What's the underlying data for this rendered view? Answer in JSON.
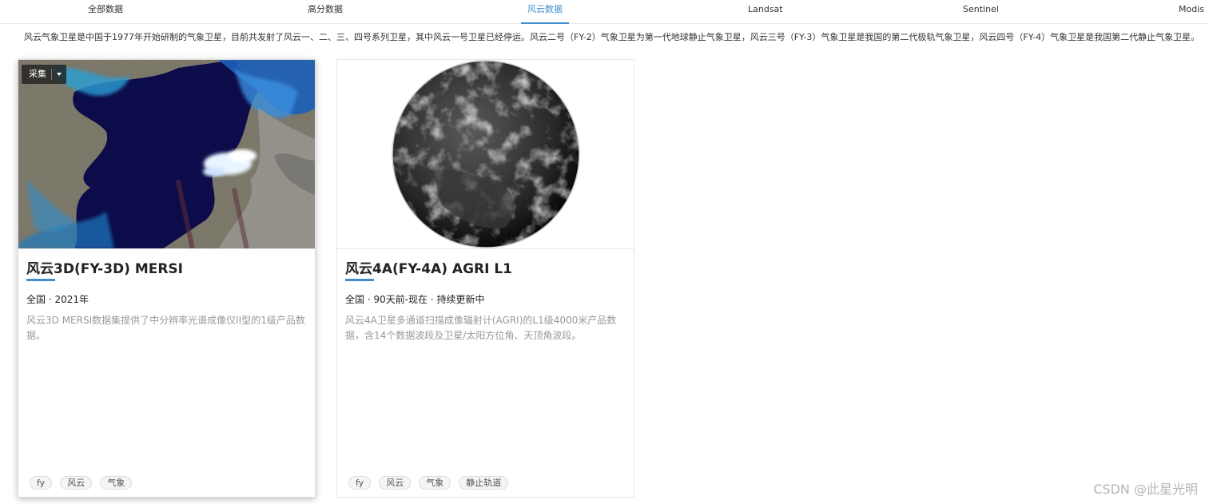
{
  "tabs": [
    {
      "label": "全部数据",
      "active": false
    },
    {
      "label": "高分数据",
      "active": false
    },
    {
      "label": "风云数据",
      "active": true
    },
    {
      "label": "Landsat",
      "active": false
    },
    {
      "label": "Sentinel",
      "active": false
    },
    {
      "label": "Modis",
      "active": false
    }
  ],
  "intro": "风云气象卫星是中国于1977年开始研制的气象卫星，目前共发射了风云一、二、三、四号系列卫星，其中风云一号卫星已经停运。风云二号（FY-2）气象卫星为第一代地球静止气象卫星，风云三号（FY-3）气象卫星是我国的第二代极轨气象卫星，风云四号（FY-4）气象卫星是我国第二代静止气象卫星。",
  "cards": [
    {
      "collect_label": "采集",
      "title": "风云3D(FY-3D) MERSI",
      "meta": "全国 · 2021年",
      "desc": "风云3D MERSI数据集提供了中分辨率光谱成像仪II型的1级产品数据。",
      "tags": [
        "fy",
        "风云",
        "气象"
      ]
    },
    {
      "title": "风云4A(FY-4A) AGRI L1",
      "meta": "全国 · 90天前-现在 · 持续更新中",
      "desc": "风云4A卫星多通道扫描成像辐射计(AGRI)的L1级4000米产品数据，含14个数据波段及卫星/太阳方位角、天顶角波段。",
      "tags": [
        "fy",
        "风云",
        "气象",
        "静止轨道"
      ]
    }
  ],
  "watermark": "CSDN @此星光明",
  "colors": {
    "accent": "#3e8ed0",
    "desc_text": "#999999"
  }
}
